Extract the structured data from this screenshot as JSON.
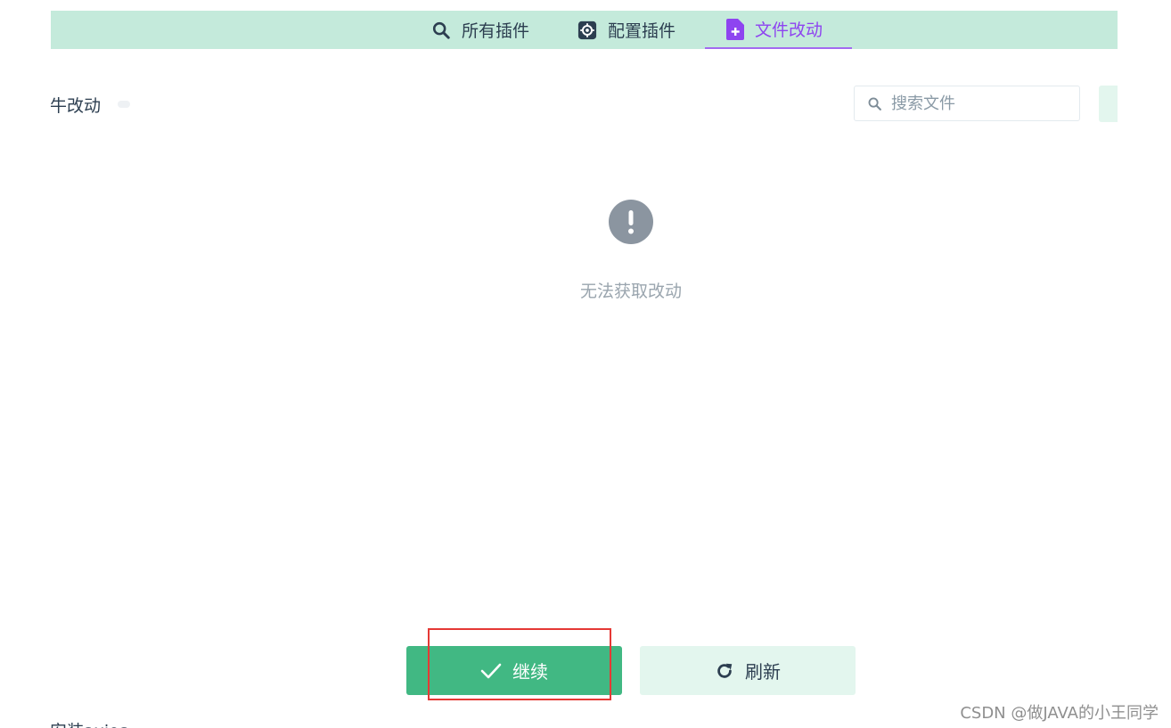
{
  "tabs": {
    "all_plugins": "所有插件",
    "config_plugins": "配置插件",
    "file_changes": "文件改动"
  },
  "colors": {
    "tab_bar_bg": "#c4eadb",
    "active_tab": "#8e44f0",
    "primary": "#41b883",
    "secondary_bg": "#e3f6ee",
    "empty_icon": "#8b95a0",
    "highlight": "#e53935"
  },
  "header": {
    "section_title": "牛改动"
  },
  "search": {
    "placeholder": "搜索文件",
    "value": ""
  },
  "empty_state": {
    "icon": "exclamation-circle-icon",
    "message": "无法获取改动"
  },
  "actions": {
    "continue_label": "继续",
    "continue_icon": "check-icon",
    "refresh_label": "刷新",
    "refresh_icon": "refresh-icon"
  },
  "footer": {
    "cut_text": "安装axios",
    "watermark": "CSDN @做JAVA的小王同学"
  }
}
